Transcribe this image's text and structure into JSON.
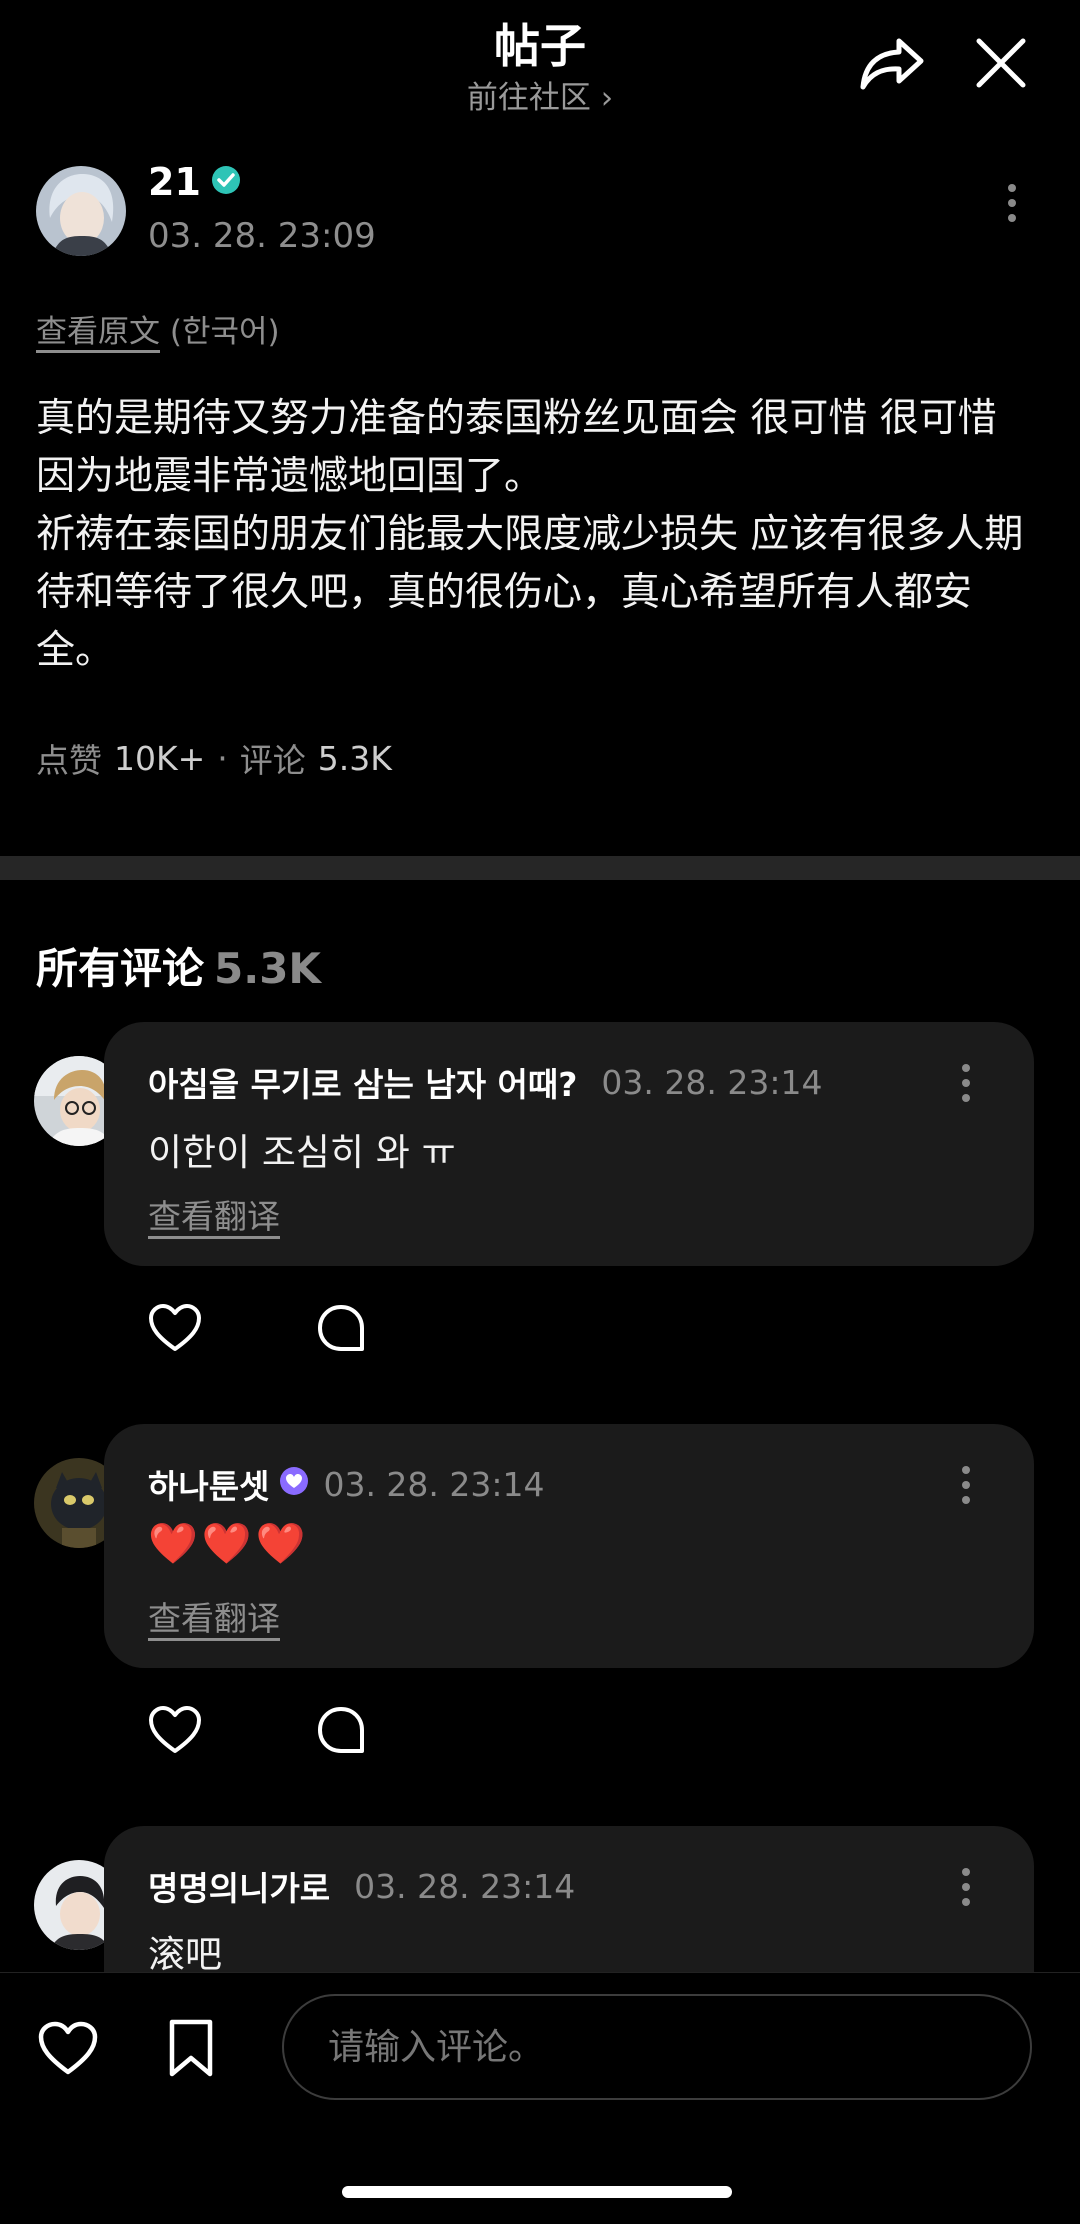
{
  "header": {
    "title": "帖子",
    "subtitle": "前往社区 ›"
  },
  "post": {
    "author": "21",
    "timestamp": "03. 28. 23:09",
    "view_original": "查看原文",
    "language": "(한국어)",
    "body_lines": [
      "真的是期待又努力准备的泰国粉丝见面会 很可惜 很可惜 因为地震非常遗憾地回国了。",
      "祈祷在泰国的朋友们能最大限度减少损失 应该有很多人期待和等待了很久吧，真的很伤心，真心希望所有人都安全。"
    ],
    "likes_label": "点赞",
    "likes_count": "10K+",
    "separator": "·",
    "comments_label": "评论",
    "comments_count": "5.3K"
  },
  "comments_section": {
    "title": "所有评论",
    "count": "5.3K",
    "items": [
      {
        "name": "아침을 무기로 삼는 남자 어때?",
        "time": "03. 28. 23:14",
        "text": "이한이 조심히 와  ㅠ",
        "translate": "查看翻译",
        "verified": false
      },
      {
        "name": "하나툰셋",
        "time": "03. 28. 23:14",
        "text": "❤️❤️❤️",
        "translate": "查看翻译",
        "verified": true
      },
      {
        "name": "명명의니가로",
        "time": "03. 28. 23:14",
        "text": "滚吧",
        "translate": "",
        "verified": false
      }
    ]
  },
  "bottom_bar": {
    "input_placeholder": "请输入评论。"
  },
  "colors": {
    "background": "#000000",
    "bubble": "#1b1b1b",
    "verified_teal": "#2ec4b6",
    "verified_purple": "#8a6bff",
    "heart_red": "#e0202a"
  },
  "icons": [
    "share-icon",
    "close-icon",
    "verified-badge-icon",
    "more-vertical-icon",
    "heart-icon",
    "comment-icon",
    "bookmark-icon"
  ]
}
